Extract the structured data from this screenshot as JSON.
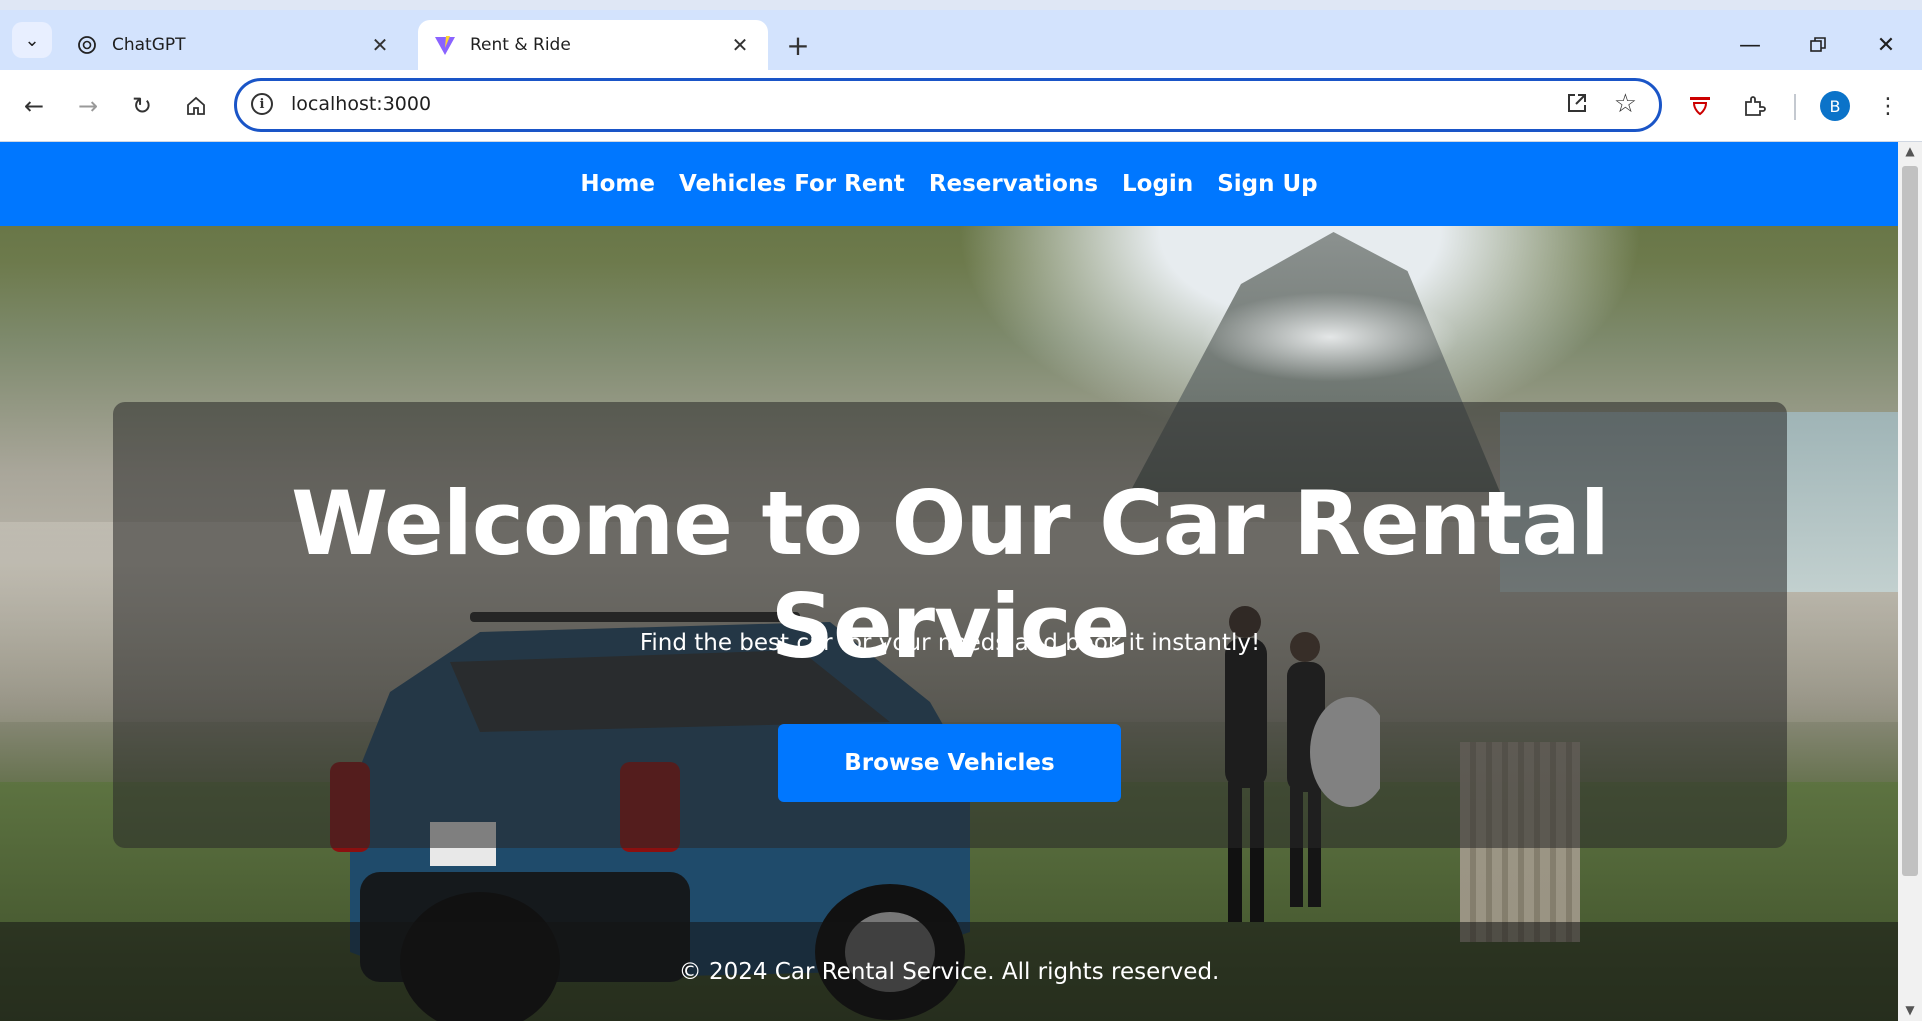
{
  "browser": {
    "tabs": [
      {
        "title": "ChatGPT",
        "icon": "openai-icon",
        "active": false
      },
      {
        "title": "Rent & Ride",
        "icon": "vite-icon",
        "active": true
      }
    ],
    "url": "localhost:3000",
    "profile_initial": "B",
    "accent_color": "#1a55c7"
  },
  "site": {
    "nav": {
      "items": [
        "Home",
        "Vehicles For Rent",
        "Reservations",
        "Login",
        "Sign Up"
      ],
      "color": "#0077ff"
    },
    "hero": {
      "title": "Welcome to Our Car Rental Service",
      "subtitle": "Find the best car for your needs and book it instantly!",
      "cta_label": "Browse Vehicles"
    },
    "footer": {
      "text": "© 2024 Car Rental Service. All rights reserved."
    }
  }
}
